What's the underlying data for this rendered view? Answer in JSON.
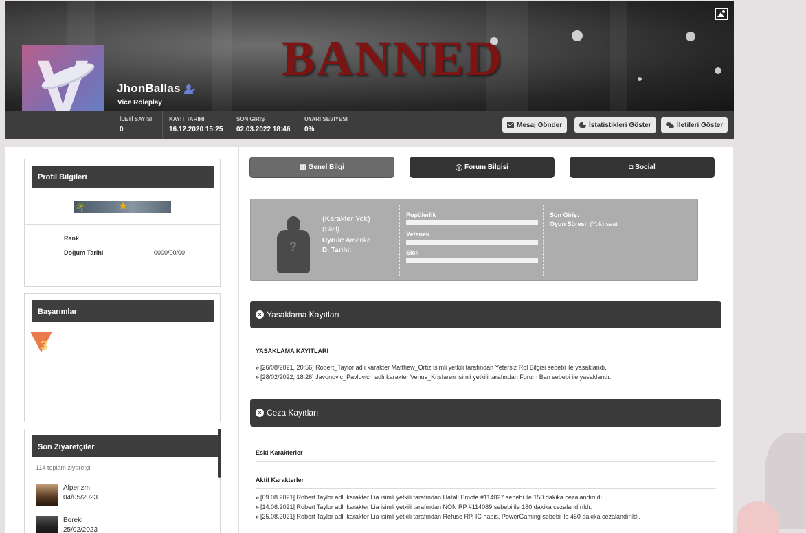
{
  "header": {
    "cover_text": "BANNED",
    "username": "JhonBallas",
    "server": "Vice Roleplay",
    "stats": [
      {
        "label": "İLETİ SAYISI",
        "value": "0"
      },
      {
        "label": "KAYIT TARIHI",
        "value": "16.12.2020 15:25"
      },
      {
        "label": "SON GIRIŞ",
        "value": "02.03.2022 18:46"
      },
      {
        "label": "UYARI SEVIYESI",
        "value": "0%"
      }
    ],
    "buttons": {
      "message": "Mesaj Gönder",
      "stats": "İstatistikleri Göster",
      "posts": "İletileri Göster"
    }
  },
  "sidebar": {
    "profile": {
      "title": "Profil Bilgileri",
      "rows": [
        {
          "label": "Rank",
          "value": ""
        },
        {
          "label": "Doğum Tarihi",
          "value": "0000/00/00"
        }
      ]
    },
    "achievements": {
      "title": "Başarımlar"
    },
    "visitors": {
      "title": "Son Ziyaretçiler",
      "total": "114 toplam ziyaretçi",
      "items": [
        {
          "name": "Alperizm",
          "date": "04/05/2023"
        },
        {
          "name": "Boreki",
          "date": "25/02/2023"
        }
      ]
    }
  },
  "tabs": [
    {
      "label": "Genel Bilgi",
      "icon": "id-card-icon"
    },
    {
      "label": "Forum Bilgisi",
      "icon": "info-icon"
    },
    {
      "label": "Social",
      "icon": "camera-icon"
    }
  ],
  "character": {
    "name": "(Karakter Yok)",
    "faction": "(Sivil)",
    "nationality_label": "Uyruk:",
    "nationality": "Amerika",
    "dob_label": "D. Tarihi:",
    "dob": "",
    "meters": [
      {
        "label": "Popülerlik",
        "value": 0
      },
      {
        "label": "Yetenek",
        "value": 0
      },
      {
        "label": "Sicil",
        "value": 0
      }
    ],
    "last_login_label": "Son Giriş:",
    "last_login": "",
    "playtime_label": "Oyun Süresi:",
    "playtime": "(Yok) saat"
  },
  "bans": {
    "title": "Yasaklama Kayıtları",
    "subtitle": "YASAKLAMA KAYITLARI",
    "entries": [
      "[26/08/2021, 20:56] Robert_Taylor adlı karakter Matthew_Ortiz isimli yetkili tarafından Yetersiz Rol Bilgisi sebebi ile yasaklandı.",
      "[28/02/2022, 18:26] Javonovic_Pavlovich adlı karakter Venus_Krisfaren isimli yetkili tarafından Forum Ban sebebi ile yasaklandı."
    ]
  },
  "penalties": {
    "title": "Ceza Kayıtları",
    "old_chars": "Eski Karakterler",
    "active_chars": "Aktif Karakterler",
    "entries": [
      "[09.08.2021] Robert Taylor adlı karakter Lia isimli yetkili tarafından Hatalı Emote #114027 sebebi ile 150 dakika cezalandırıldı.",
      "[14.08.2021] Robert Taylor adlı karakter Lia isimli yetkili tarafından NON RP #114089 sebebi ile 180 dakika cezalandırıldı.",
      "[25.08.2021] Robert Taylor adlı karakter Lia isimli yetkili tarafından Refuse RP, IC hapis, PowerGaming sebebi ile 450 dakika cezalandırıldı."
    ]
  },
  "colors": {
    "banned_text": "#7d1414",
    "header_bg": "#3a3a3a",
    "panel_gray": "#adadad",
    "user_icon": "#6b7fd6"
  }
}
